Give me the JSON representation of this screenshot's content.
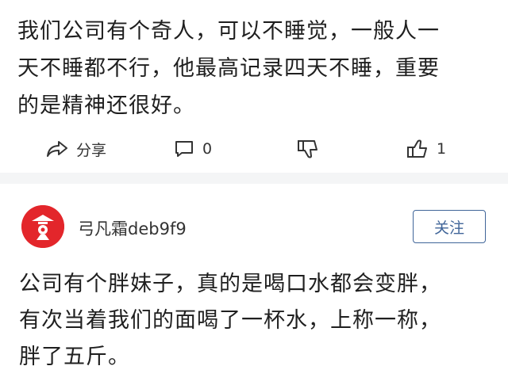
{
  "post": {
    "text_lines": [
      "我们公司有个奇人，可以不睡觉，一般人一",
      "天不睡都不行，他最高记录四天不睡，重要",
      "的是精神还很好。"
    ]
  },
  "actions": {
    "share_label": "分享",
    "comment_count": "0",
    "like_count": "1"
  },
  "comment": {
    "author": "弓凡霜deb9f9",
    "follow_label": "关注",
    "text_lines": [
      "公司有个胖妹子，真的是喝口水都会变胖，",
      "有次当着我们的面喝了一杯水，上称一称，",
      "胖了五斤。"
    ]
  },
  "colors": {
    "accent": "#406599",
    "avatar_bg": "#e3262b",
    "divider": "#f4f5f6"
  },
  "icons": {
    "share": "share-arrow-icon",
    "comment": "comment-bubble-icon",
    "dislike": "thumbs-down-icon",
    "like": "thumbs-up-icon"
  }
}
